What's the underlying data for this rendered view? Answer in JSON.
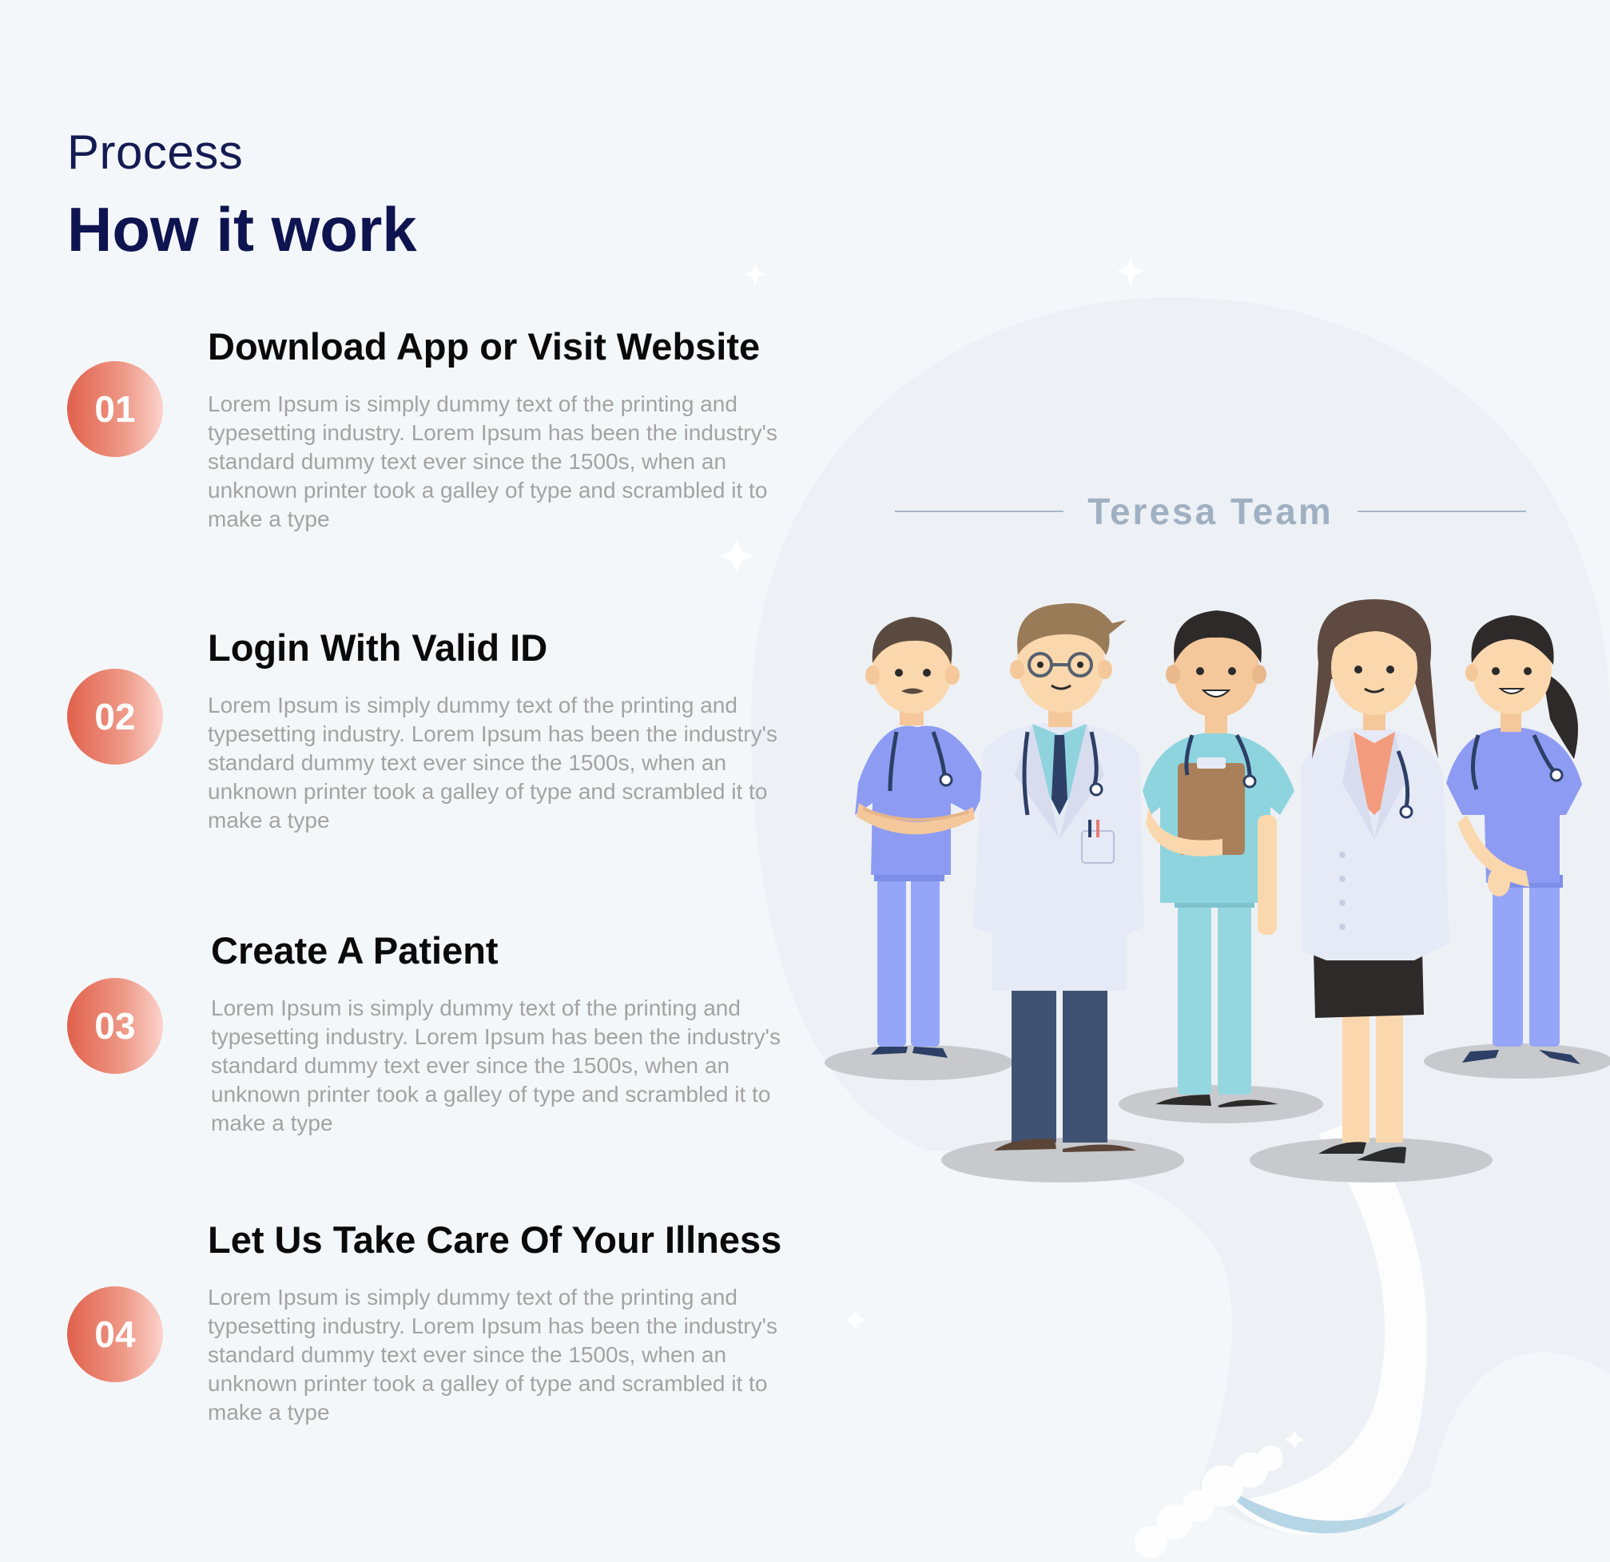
{
  "header": {
    "eyebrow": "Process",
    "title": "How it work"
  },
  "steps": [
    {
      "number": "01",
      "title": "Download App or Visit Website",
      "text": "Lorem Ipsum is simply dummy text of the printing and typesetting industry. Lorem Ipsum has been the industry's standard dummy text ever since the 1500s, when an unknown printer took a galley of type and scrambled it to make a type"
    },
    {
      "number": "02",
      "title": "Login With Valid ID",
      "text": "Lorem Ipsum is simply dummy text of the printing and typesetting industry. Lorem Ipsum has been the industry's standard dummy text ever since the 1500s, when an unknown printer took a galley of type and scrambled it to make a type"
    },
    {
      "number": "03",
      "title": "Create A Patient",
      "text": "Lorem Ipsum is simply dummy text of the printing and typesetting industry. Lorem Ipsum has been the industry's standard dummy text ever since the 1500s, when an unknown printer took a galley of type and scrambled it to make a type"
    },
    {
      "number": "04",
      "title": "Let Us Take Care Of Your Illness",
      "text": "Lorem Ipsum is simply dummy text of the printing and typesetting industry. Lorem Ipsum has been the industry's standard dummy text ever since the 1500s, when an unknown printer took a galley of type and scrambled it to make a type"
    }
  ],
  "team": {
    "label": "Teresa Team"
  },
  "colors": {
    "background": "#f4f7fa",
    "title_navy": "#0e1450",
    "badge_red": "#e1614c",
    "badge_light": "#fbd3cc",
    "body_text_gray": "#a3a3a3",
    "team_label": "#9fb0c3"
  },
  "icons": {
    "illustration": "medical-team-illustration",
    "sparkle": "sparkle-icon"
  }
}
